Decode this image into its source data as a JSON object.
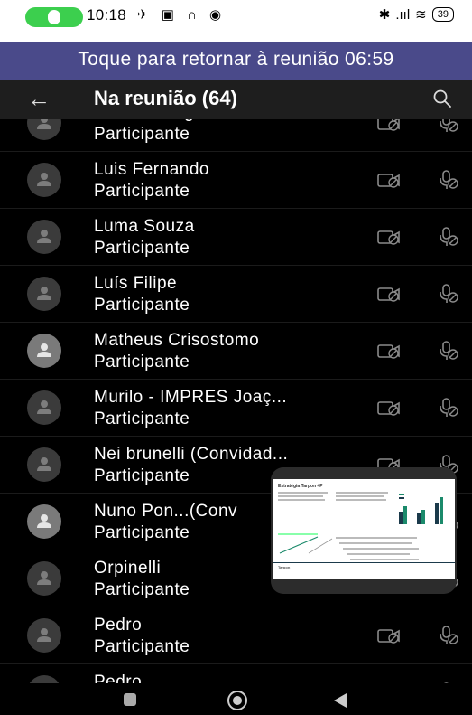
{
  "status_bar": {
    "time": "10:18",
    "notification_icons": "✈ ▣ ∩ ◉",
    "battery": "39"
  },
  "banner": {
    "text": "Toque para retornar à reunião 06:59",
    "background": "#4a4a8a"
  },
  "header": {
    "title": "Na reunião (64)",
    "back_icon": "arrow-left-icon",
    "search_icon": "search-icon"
  },
  "participants": [
    {
      "name": "Luana Ortega",
      "role": "Participante",
      "avatar": "dark"
    },
    {
      "name": "Luis Fernando",
      "role": "Participante",
      "avatar": "dark"
    },
    {
      "name": "Luma Souza",
      "role": "Participante",
      "avatar": "dark"
    },
    {
      "name": "Luís Filipe",
      "role": "Participante",
      "avatar": "dark"
    },
    {
      "name": "Matheus Crisostomo",
      "role": "Participante",
      "avatar": "light"
    },
    {
      "name": "Murilo - IMPRES Joaç...",
      "role": "Participante",
      "avatar": "dark"
    },
    {
      "name": "Nei brunelli (Convidad...",
      "role": "Participante",
      "avatar": "dark"
    },
    {
      "name": "Nuno Pon...(Conv",
      "role": "Participante",
      "avatar": "light"
    },
    {
      "name": "Orpinelli",
      "role": "Participante",
      "avatar": "dark"
    },
    {
      "name": "Pedro",
      "role": "Participante",
      "avatar": "dark"
    },
    {
      "name": "Pedro",
      "role": "",
      "avatar": "dark"
    }
  ],
  "preview": {
    "slide_title": "Estratégia Tarpon 4P",
    "slide_footer": "Tarpon"
  },
  "nav": {
    "recents": "recents-icon",
    "home": "home-icon",
    "back": "back-icon"
  }
}
